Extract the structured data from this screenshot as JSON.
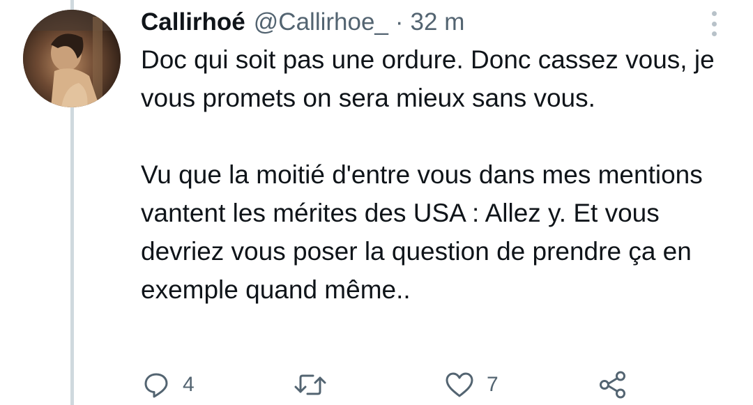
{
  "tweet": {
    "display_name": "Callirhoé",
    "handle": "@Callirhoe_",
    "separator": "·",
    "time": "32 m",
    "paragraphs": [
      "Doc qui soit pas une ordure. Donc cassez vous, je vous promets on sera mieux sans vous.",
      "Vu que la moitié d'entre vous dans mes mentions vantent les mérites des USA : Allez y. Et vous devriez vous poser la question de prendre ça en exemple quand même.."
    ]
  },
  "actions": {
    "reply_count": "4",
    "retweet_count": "",
    "like_count": "7"
  },
  "icons": {
    "more": "more-vertical-icon",
    "reply": "reply-icon",
    "retweet": "retweet-icon",
    "like": "heart-icon",
    "share": "share-icon"
  },
  "colors": {
    "text": "#0f1419",
    "secondary": "#536471",
    "thread_line": "#cfd9de"
  }
}
